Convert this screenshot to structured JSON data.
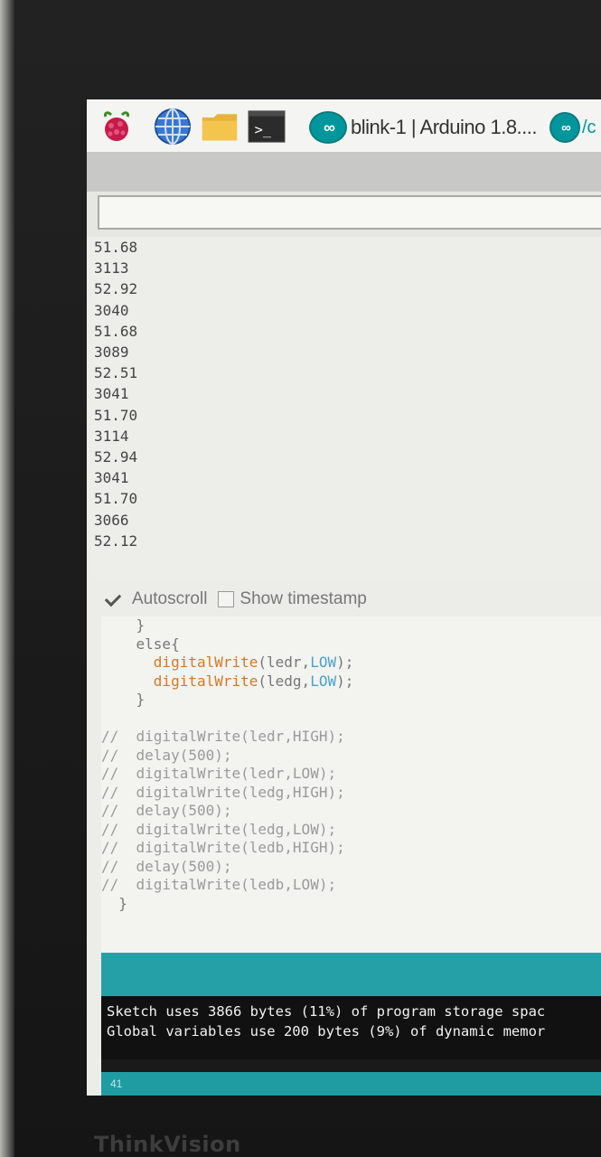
{
  "taskbar": {
    "apps": [
      {
        "name": "raspberry-menu",
        "icon": "raspberry-icon"
      },
      {
        "name": "web-browser",
        "icon": "globe-icon"
      },
      {
        "name": "file-manager",
        "icon": "folder-icon"
      },
      {
        "name": "terminal",
        "icon": "terminal-icon",
        "glyph": ">_"
      }
    ],
    "window_tab_title": "blink-1 | Arduino 1.8....",
    "second_tab_fragment": "/c"
  },
  "serial_monitor": {
    "output_lines": [
      "51.68",
      "3113",
      "52.92",
      "3040",
      "51.68",
      "3089",
      "52.51",
      "3041",
      "51.70",
      "3114",
      "52.94",
      "3041",
      "51.70",
      "3066",
      "52.12"
    ],
    "autoscroll_label": "Autoscroll",
    "autoscroll_checked": true,
    "show_timestamp_label": "Show timestamp",
    "show_timestamp_checked": false
  },
  "editor": {
    "lines": [
      {
        "indent": "    ",
        "text": "}"
      },
      {
        "indent": "    ",
        "text": "else{"
      },
      {
        "indent": "      ",
        "kw": "digitalWrite",
        "args": "(ledr,",
        "const": "LOW",
        "end": ");"
      },
      {
        "indent": "      ",
        "kw": "digitalWrite",
        "args": "(ledg,",
        "const": "LOW",
        "end": ");"
      },
      {
        "indent": "    ",
        "text": "}"
      },
      {
        "indent": "",
        "text": ""
      },
      {
        "indent": "//  ",
        "comment": "digitalWrite(ledr,HIGH);"
      },
      {
        "indent": "//  ",
        "comment": "delay(500);"
      },
      {
        "indent": "//  ",
        "comment": "digitalWrite(ledr,LOW);"
      },
      {
        "indent": "//  ",
        "comment": "digitalWrite(ledg,HIGH);"
      },
      {
        "indent": "//  ",
        "comment": "delay(500);"
      },
      {
        "indent": "//  ",
        "comment": "digitalWrite(ledg,LOW);"
      },
      {
        "indent": "//  ",
        "comment": "digitalWrite(ledb,HIGH);"
      },
      {
        "indent": "//  ",
        "comment": "delay(500);"
      },
      {
        "indent": "//  ",
        "comment": "digitalWrite(ledb,LOW);"
      },
      {
        "indent": "  ",
        "text": "}"
      }
    ]
  },
  "console": {
    "line1": "Sketch uses 3866 bytes (11%) of program storage spac",
    "line2": "Global variables use 200 bytes (9%) of dynamic memor"
  },
  "status": {
    "line_number": "41"
  },
  "monitor_brand": "ThinkVision",
  "colors": {
    "arduino_teal": "#00979c",
    "keyword_orange": "#d07a2a",
    "constant_blue": "#4aa3c8",
    "console_bg": "#111111"
  }
}
